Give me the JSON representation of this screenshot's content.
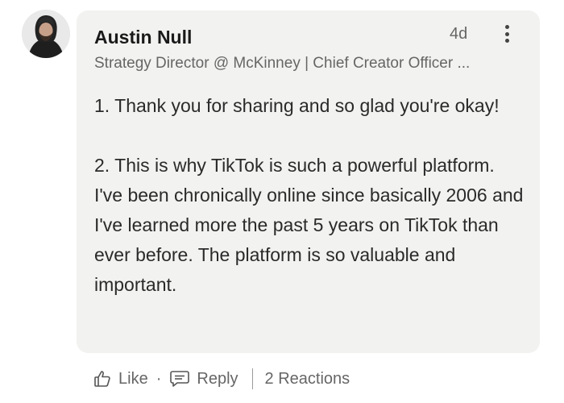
{
  "comment": {
    "author": "Austin Null",
    "headline": "Strategy Director @ McKinney | Chief Creator Officer ...",
    "time": "4d",
    "paragraphs": [
      "1. Thank you for sharing and so glad you're okay!",
      "2. This is why TikTok is such a powerful platform. I've been chronically online since basically 2006 and I've learned more the past 5 years on TikTok than ever before. The platform is so valuable and important."
    ]
  },
  "actions": {
    "like_label": "Like",
    "dot": "·",
    "reply_label": "Reply",
    "reactions_label": "2 Reactions"
  },
  "icons": {
    "like": "thumbs-up-icon",
    "reply": "comment-icon",
    "more": "more-vertical-icon"
  },
  "colors": {
    "bubble": "#f2f2f0",
    "secondary_text": "#666666"
  }
}
